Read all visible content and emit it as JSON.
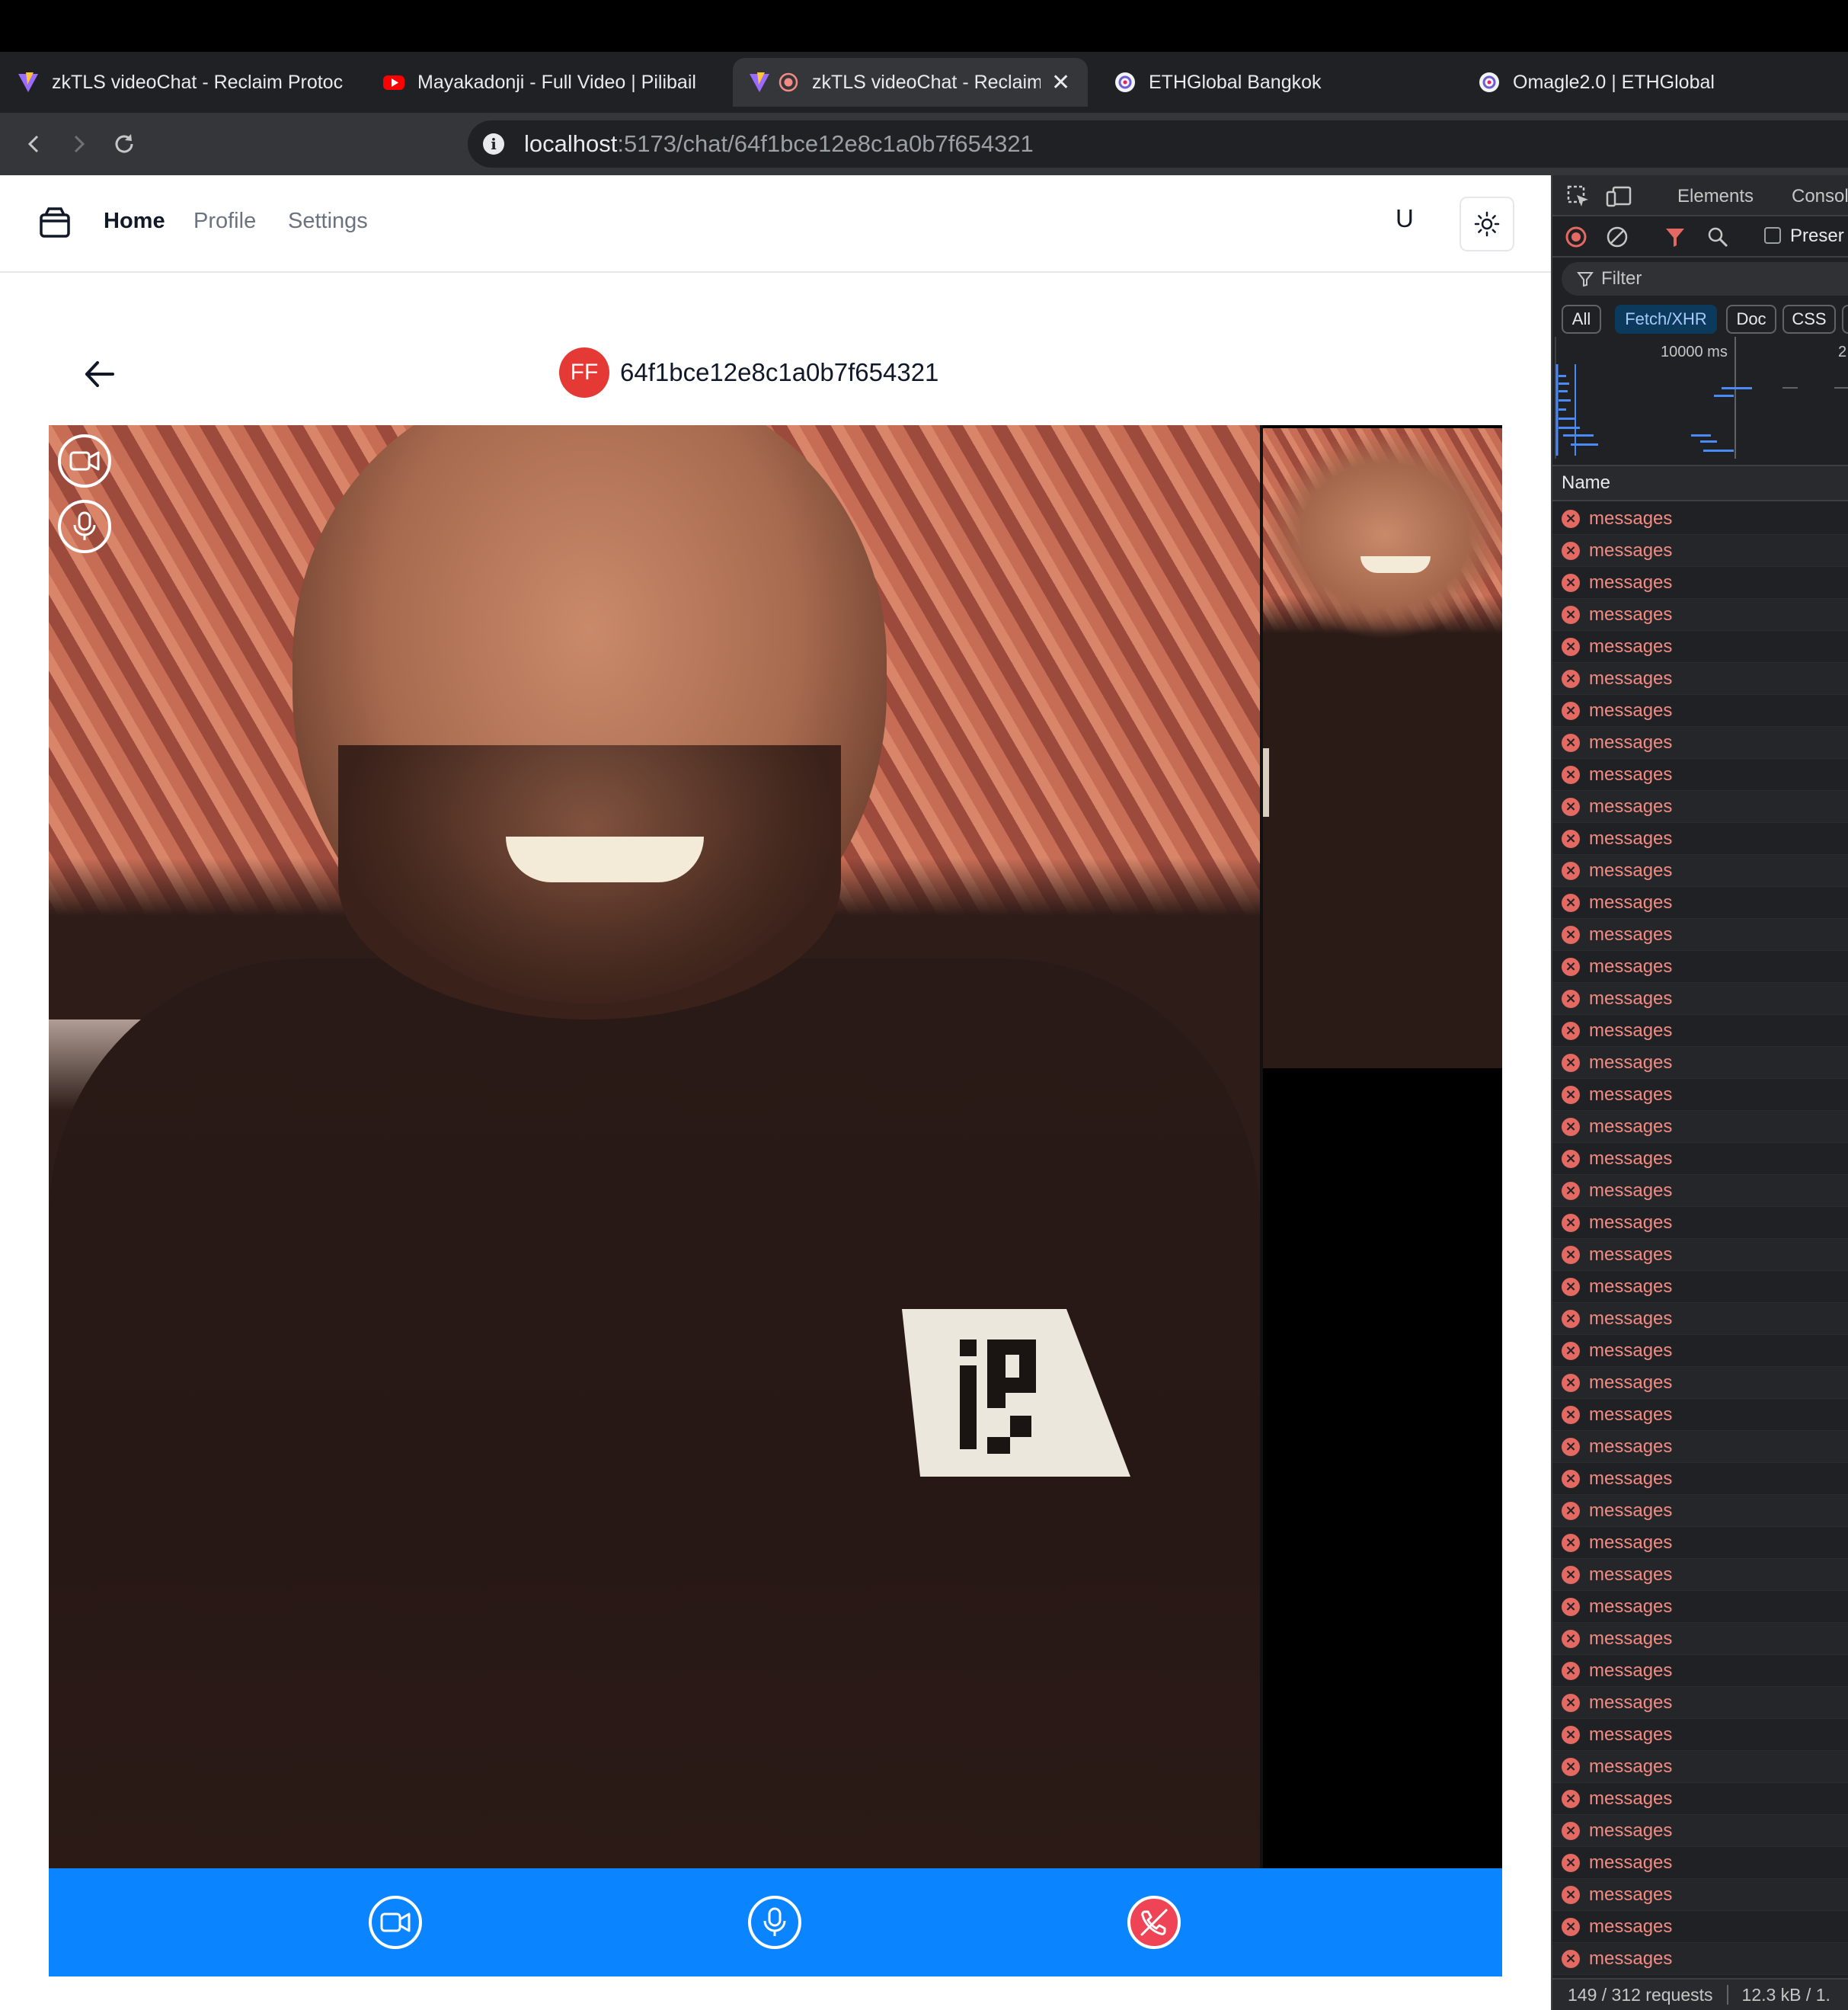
{
  "browser": {
    "tabs": [
      {
        "title": "zkTLS videoChat - Reclaim Protoc",
        "active": false
      },
      {
        "title": "Mayakadonji - Full Video | Pilibail",
        "active": false
      },
      {
        "title": "zkTLS videoChat - Reclaim",
        "active": true
      },
      {
        "title": "ETHGlobal Bangkok",
        "active": false
      },
      {
        "title": "Omagle2.0 | ETHGlobal",
        "active": false
      }
    ],
    "close_glyph": "✕",
    "url_host": "localhost",
    "url_path": ":5173/chat/64f1bce12e8c1a0b7f654321"
  },
  "app": {
    "nav": {
      "home": "Home",
      "profile": "Profile",
      "settings": "Settings",
      "user_initial": "U"
    },
    "chat": {
      "avatar_initials": "FF",
      "peer_id": "64f1bce12e8c1a0b7f654321"
    },
    "colors": {
      "control_bar": "#0a84ff",
      "hangup": "#ef4455",
      "avatar": "#e53935"
    }
  },
  "devtools": {
    "tabs": {
      "elements": "Elements",
      "console": "Consol"
    },
    "preserve_label": "Preser",
    "filter_placeholder": "Filter",
    "chips": [
      "All",
      "Fetch/XHR",
      "Doc",
      "CSS"
    ],
    "timeline_label": "10000 ms",
    "timeline_label_2": "2",
    "name_header": "Name",
    "row_label": "messages",
    "row_count": 46,
    "status_requests": "149 / 312 requests",
    "status_size": "12.3 kB / 1."
  }
}
